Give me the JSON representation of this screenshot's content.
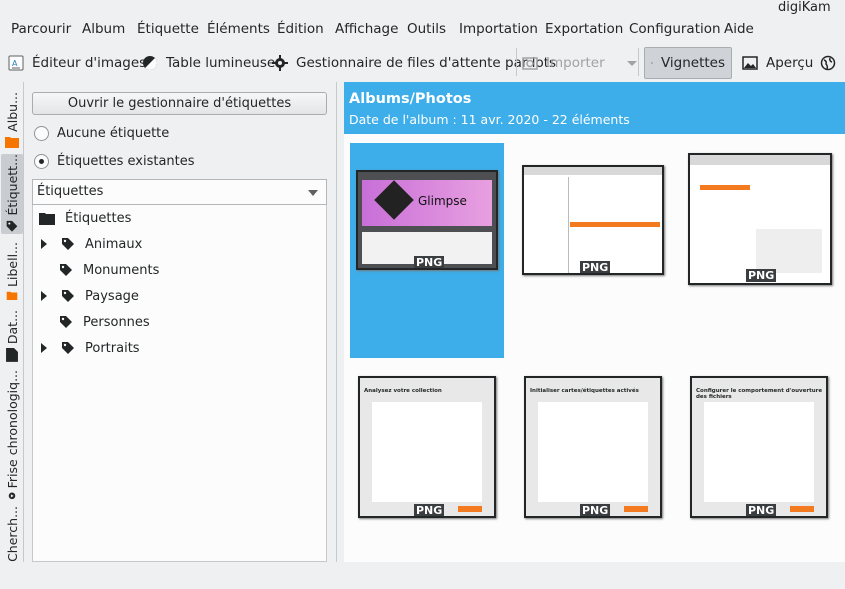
{
  "window": {
    "title": "digiKam"
  },
  "menu": [
    "Parcourir",
    "Album",
    "Étiquette",
    "Éléments",
    "Édition",
    "Affichage",
    "Outils",
    "Importation",
    "Exportation",
    "Configuration",
    "Aide"
  ],
  "toolbar": {
    "image_editor": "Éditeur d'images",
    "light_table": "Table lumineuse",
    "batch_queue": "Gestionnaire de files d'attente par lots",
    "import": "Importer",
    "thumbnails": "Vignettes",
    "preview": "Aperçu"
  },
  "side_tabs": [
    "Albu...",
    "Étiquett...",
    "Libell...",
    "Dat...",
    "Frise chronologiq...",
    "Cherch..."
  ],
  "tags_panel": {
    "open_manager": "Ouvrir le gestionnaire d'étiquettes",
    "no_tag": "Aucune étiquette",
    "existing_tags": "Étiquettes existantes",
    "combo_value": "Étiquettes",
    "root": "Étiquettes",
    "items": [
      {
        "label": "Animaux",
        "expandable": true
      },
      {
        "label": "Monuments",
        "expandable": false
      },
      {
        "label": "Paysage",
        "expandable": true
      },
      {
        "label": "Personnes",
        "expandable": false
      },
      {
        "label": "Portraits",
        "expandable": true
      }
    ]
  },
  "album": {
    "title": "Albums/Photos",
    "subtitle": "Date de l'album : 11 avr. 2020 - 22 éléments",
    "badge": "PNG",
    "thumbs": [
      {
        "caption": "Glimpse"
      },
      {},
      {},
      {
        "caption": "Analysez votre collection"
      },
      {
        "caption": "Initialiser cartes/étiquettes activés"
      },
      {
        "caption": "Configurer le comportement d'ouverture des fichiers"
      }
    ]
  },
  "colors": {
    "accent": "#3daee9",
    "bg": "#eff0f1",
    "folder": "#f67400"
  }
}
